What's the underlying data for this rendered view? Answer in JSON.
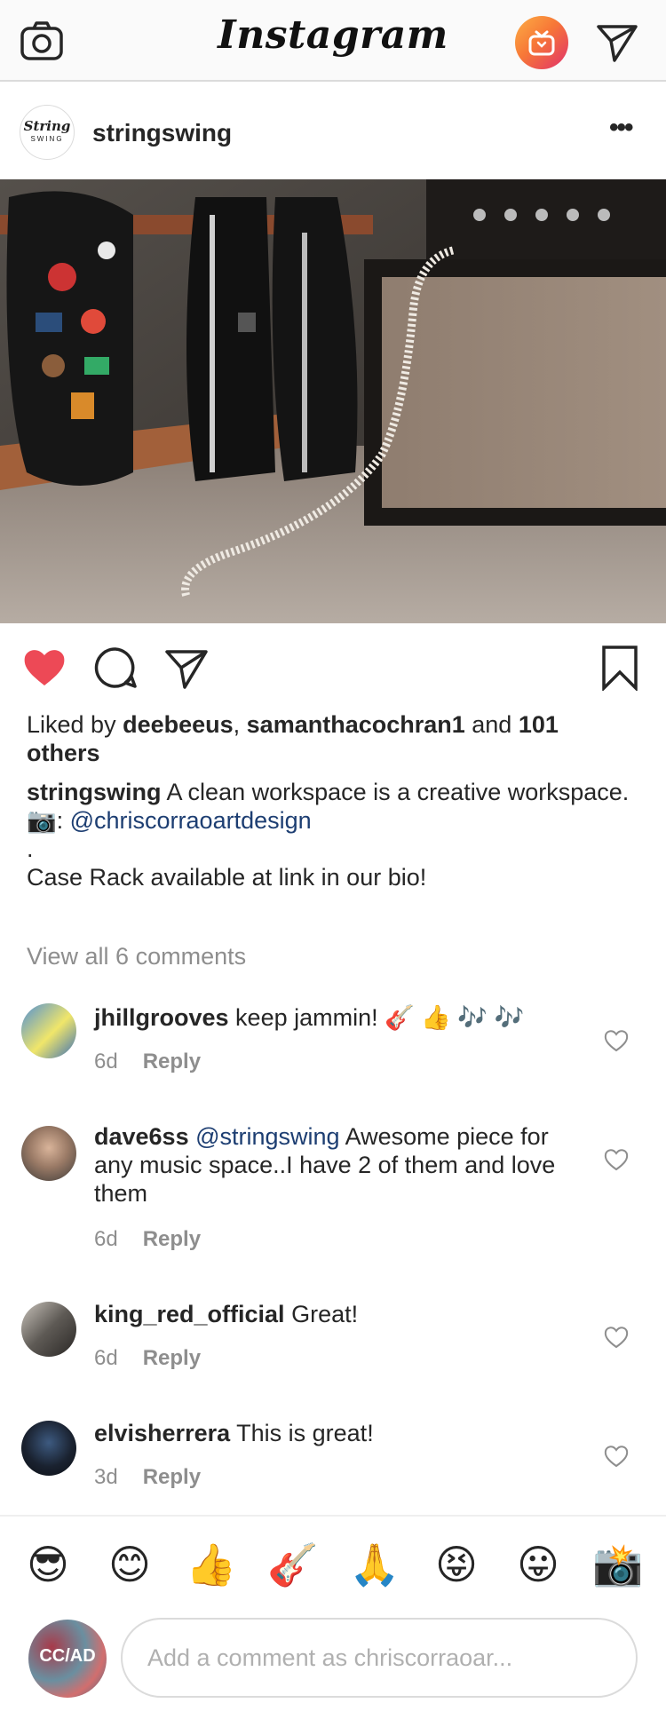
{
  "header": {
    "logo_text": "Instagram",
    "camera_icon": "camera-icon",
    "igtv_icon": "igtv-icon",
    "direct_icon": "paper-plane-icon"
  },
  "post": {
    "username": "stringswing",
    "avatar_text_1": "String",
    "avatar_text_2": "SWING",
    "more_label": "•••",
    "photo_alt": "guitar-cases-and-amp-photo",
    "liked_by_prefix": "Liked by ",
    "liked_user_1": "deebeeus",
    "liked_sep": ", ",
    "liked_user_2": "samanthacochran1",
    "liked_and": " and ",
    "liked_count": "101 others",
    "caption_user": "stringswing",
    "caption_line_1": " A clean workspace is a creative workspace.",
    "caption_camera": "📷: ",
    "caption_mention": "@chriscorraoartdesign",
    "caption_dot": ".",
    "caption_line_3": "Case Rack available at link in our bio!",
    "view_all": "View all 6 comments",
    "liked": true
  },
  "comments": [
    {
      "user": "jhillgrooves",
      "text": " keep jammin! 🎸 👍 🎶 🎶",
      "mention": "",
      "age": "6d",
      "reply": "Reply"
    },
    {
      "user": "dave6ss",
      "mention": " @stringswing",
      "text": " Awesome piece for any music space..I have 2 of them and love them",
      "age": "6d",
      "reply": "Reply"
    },
    {
      "user": "king_red_official",
      "text": " Great!",
      "mention": "",
      "age": "6d",
      "reply": "Reply"
    },
    {
      "user": "elvisherrera",
      "text": " This is great!",
      "mention": "",
      "age": "3d",
      "reply": "Reply"
    }
  ],
  "emoji_bar": [
    "😎",
    "😊",
    "👍",
    "🎸",
    "🙏",
    "😝",
    "😛",
    "📸"
  ],
  "composer": {
    "avatar_text": "CC/AD",
    "placeholder": "Add a comment as chriscorraoar..."
  },
  "colors": {
    "like_red": "#ed4956",
    "mention_blue": "#1d3e72",
    "muted_gray": "#8e8e8e"
  }
}
